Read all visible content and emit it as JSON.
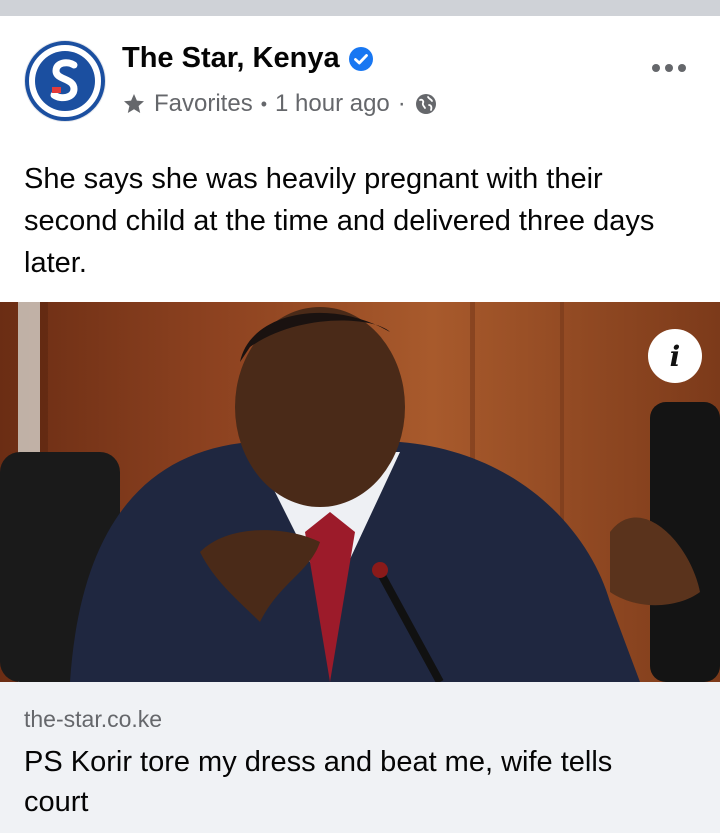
{
  "post": {
    "page_name": "The Star, Kenya",
    "audience_label": "Favorites",
    "timestamp": "1 hour ago",
    "separator": "·",
    "message": "She says she was heavily pregnant with their second child at the time and delivered three days later.",
    "icons": {
      "avatar": "the-star-logo",
      "verified": "verified-badge-icon",
      "favorites": "star-icon",
      "privacy": "globe-icon",
      "more": "more-options-icon",
      "info": "info-icon"
    },
    "colors": {
      "brand_blue": "#1877f2",
      "logo_blue": "#1b4fa0",
      "secondary_text": "#65676b"
    }
  },
  "link_preview": {
    "domain": "the-star.co.ke",
    "headline": "PS Korir tore my dress and beat me, wife tells court"
  }
}
